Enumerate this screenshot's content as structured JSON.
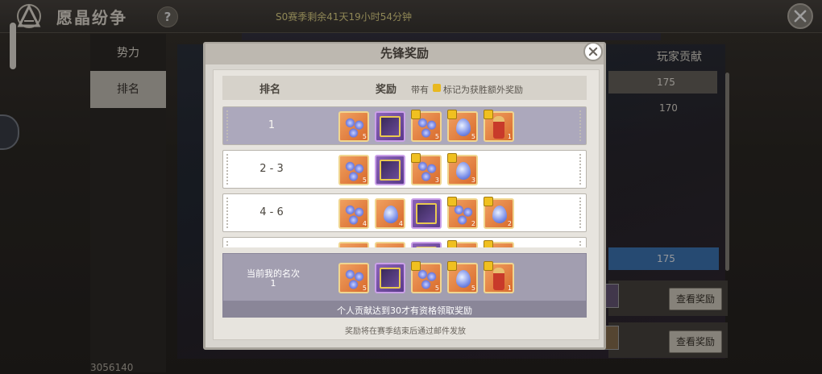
{
  "header": {
    "title": "愿晶纷争",
    "help_label": "?",
    "season_text": "S0赛季剩余41天19小时54分钟",
    "close_icon": "close-x-icon"
  },
  "sidebar": {
    "tabs": [
      {
        "label": "势力",
        "selected": false
      },
      {
        "label": "排名",
        "selected": true
      }
    ],
    "bottom_number": "3056140"
  },
  "background_list": {
    "column_header": "玩家贡献",
    "rows": [
      "175",
      "170",
      "175"
    ],
    "view_button_label": "查看奖励"
  },
  "modal": {
    "title": "先锋奖励",
    "columns": {
      "rank": "排名",
      "reward": "奖励",
      "note_prefix": "带有",
      "note_suffix": "标记为获胜额外奖励"
    },
    "rows": [
      {
        "rank": "1",
        "items": [
          {
            "type": "gems",
            "count": "5",
            "bonus": false
          },
          {
            "type": "frame",
            "count": "",
            "bonus": false
          },
          {
            "type": "gems",
            "count": "5",
            "bonus": true
          },
          {
            "type": "gem",
            "count": "5",
            "bonus": true
          },
          {
            "type": "figure",
            "count": "1",
            "bonus": true
          }
        ]
      },
      {
        "rank": "2 - 3",
        "items": [
          {
            "type": "gems",
            "count": "5",
            "bonus": false
          },
          {
            "type": "frame",
            "count": "",
            "bonus": false
          },
          {
            "type": "gems",
            "count": "3",
            "bonus": true
          },
          {
            "type": "gem",
            "count": "3",
            "bonus": true
          }
        ]
      },
      {
        "rank": "4 - 6",
        "items": [
          {
            "type": "gems",
            "count": "4",
            "bonus": false
          },
          {
            "type": "gem",
            "count": "4",
            "bonus": false
          },
          {
            "type": "frame",
            "count": "",
            "bonus": false
          },
          {
            "type": "gems",
            "count": "2",
            "bonus": true
          },
          {
            "type": "gem",
            "count": "2",
            "bonus": true
          }
        ]
      },
      {
        "rank": "",
        "items": [
          {
            "type": "gems",
            "count": "",
            "bonus": false
          },
          {
            "type": "gem",
            "count": "",
            "bonus": false
          },
          {
            "type": "frame",
            "count": "",
            "bonus": false
          },
          {
            "type": "gems",
            "count": "",
            "bonus": true
          },
          {
            "type": "gem",
            "count": "",
            "bonus": true
          }
        ]
      }
    ],
    "my_rank": {
      "label": "当前我的名次",
      "value": "1",
      "items": [
        {
          "type": "gems",
          "count": "5",
          "bonus": false
        },
        {
          "type": "frame",
          "count": "",
          "bonus": false
        },
        {
          "type": "gems",
          "count": "5",
          "bonus": true
        },
        {
          "type": "gem",
          "count": "5",
          "bonus": true
        },
        {
          "type": "figure",
          "count": "1",
          "bonus": true
        }
      ],
      "requirement": "个人贡献达到30才有资格领取奖励"
    },
    "footer": "奖励将在赛季结束后通过邮件发放"
  }
}
